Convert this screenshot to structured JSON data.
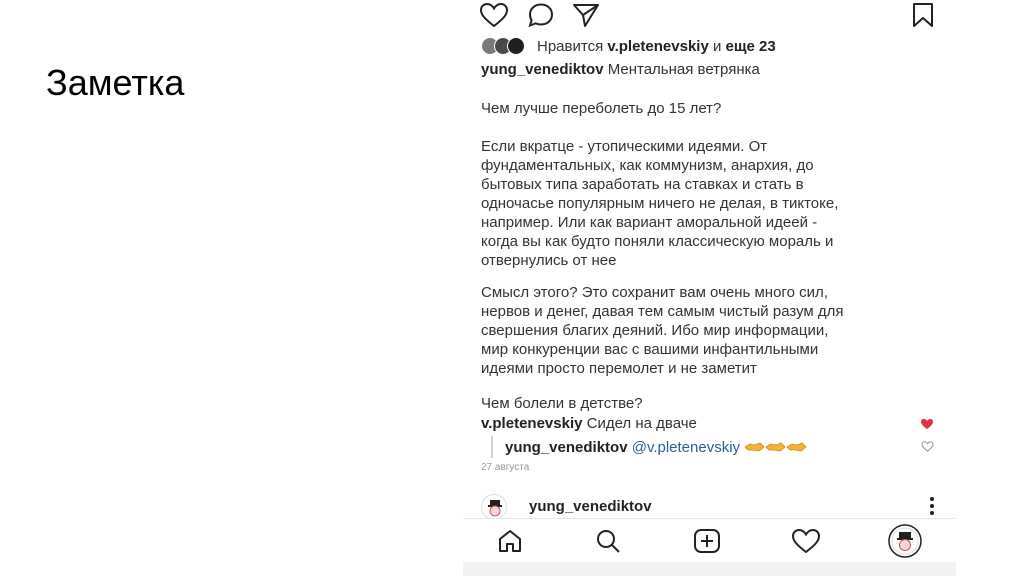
{
  "slide": {
    "title": "Заметка"
  },
  "post": {
    "actions": {
      "like_icon": "heart-outline-icon",
      "comment_icon": "comment-bubble-icon",
      "share_icon": "send-paper-plane-icon",
      "save_icon": "bookmark-icon"
    },
    "likes": {
      "prefix": "Нравится ",
      "user": "v.pletenevskiy",
      "middle": " и ",
      "others": "еще 23"
    },
    "caption": {
      "author": "yung_venediktov",
      "title": "Ментальная ветрянка",
      "paragraphs": [
        "Чем лучше переболеть до 15 лет?",
        "Если вкратце - утопическими идеями. От\nфундаментальных, как коммунизм, анархия, до\nбытовых типа заработать на ставках и стать в\nодночасье популярным ничего не делая, в тиктоке,\nнапример. Или как вариант аморальной идеей -\nкогда вы как будто поняли классическую мораль и\nотвернулись от нее",
        "Смысл этого? Это сохранит вам очень много сил,\nнервов и денег, давая тем самым чистый разум для\nсвершения благих деяний. Ибо мир информации,\nмир конкуренции вас с вашими инфантильными\nидеями просто перемолет и не заметит",
        "Чем болели в детстве?"
      ]
    },
    "comments": [
      {
        "user": "v.pletenevskiy",
        "text": "Сидел на дваче",
        "liked": true
      }
    ],
    "reply": {
      "user": "yung_venediktov",
      "mention": "@v.pletenevskiy",
      "emoji": "handshake-icon"
    },
    "date": "27 августа",
    "next_post_author": "yung_venediktov"
  },
  "tabbar": {
    "items": [
      "home-icon",
      "search-icon",
      "new-post-icon",
      "activity-heart-icon",
      "profile-avatar-icon"
    ]
  },
  "colors": {
    "liked_heart": "#e0344c",
    "mention": "#2f5f9a",
    "divider": "#e6e6e6"
  }
}
